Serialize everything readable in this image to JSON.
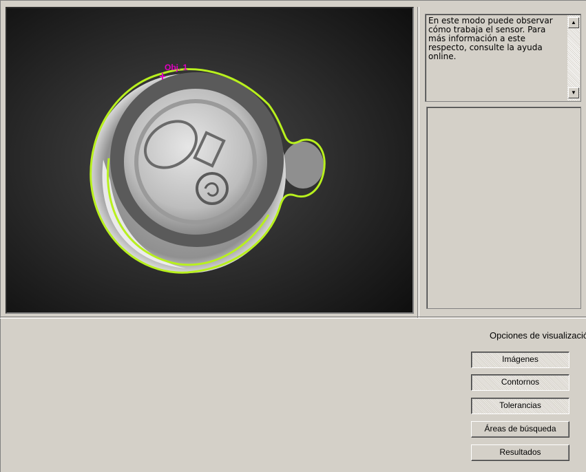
{
  "image_panel": {
    "object_label": "Obj. 1",
    "contour_color": "#b8f01e",
    "label_color": "#e000c0"
  },
  "help": {
    "text": "En este modo puede observar cómo trabaja el sensor. Para más información a este respecto, consulte la ayuda online.",
    "scroll_up_icon": "scroll-up-arrow",
    "scroll_down_icon": "scroll-down-arrow"
  },
  "options": {
    "title": "Opciones de visualizació",
    "buttons": [
      {
        "label": "Imágenes",
        "pressed": true
      },
      {
        "label": "Contornos",
        "pressed": true
      },
      {
        "label": "Tolerancias",
        "pressed": true
      },
      {
        "label": "Áreas de búsqueda",
        "pressed": false
      },
      {
        "label": "Resultados",
        "pressed": false
      }
    ]
  }
}
